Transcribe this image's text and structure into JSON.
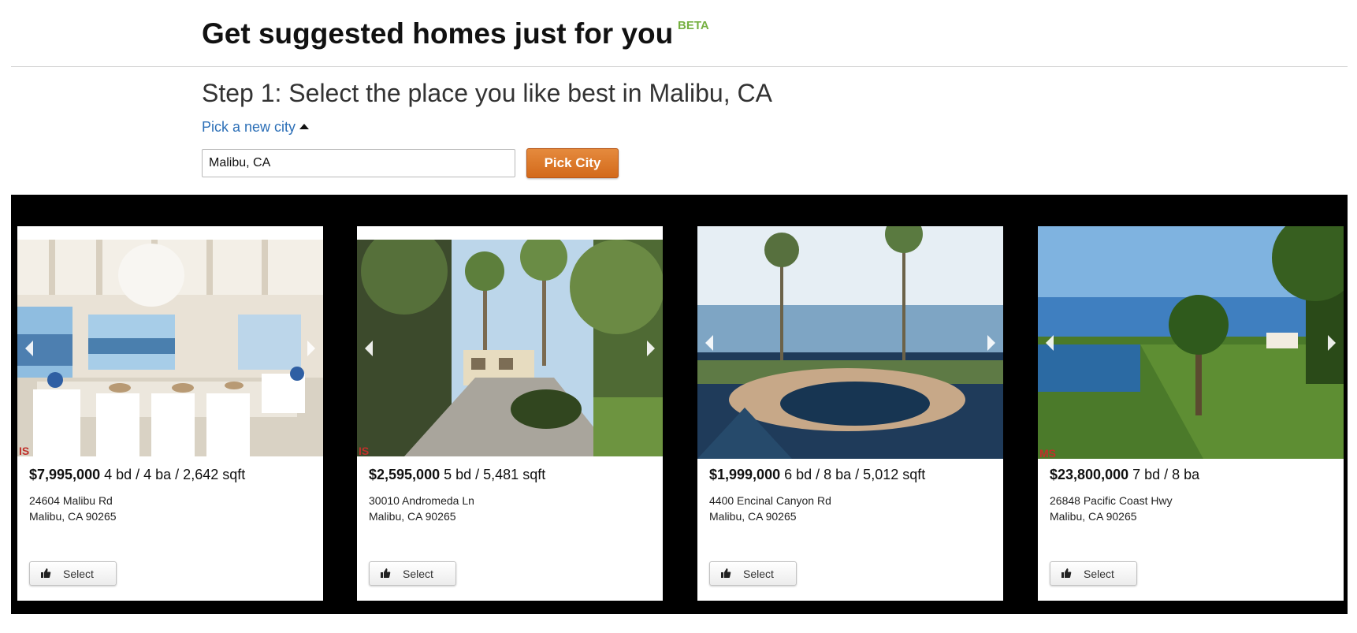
{
  "header": {
    "title": "Get suggested homes just for you",
    "badge": "BETA"
  },
  "step": {
    "title": "Step 1: Select the place you like best in Malibu, CA",
    "pick_link": "Pick a new city",
    "city_value": "Malibu, CA",
    "pick_button": "Pick City"
  },
  "colors": {
    "accent_orange": "#d9732a",
    "link_blue": "#2c6fb7",
    "beta_green": "#76b041",
    "strip_background": "#000000"
  },
  "icons": {
    "carousel_prev": "caret-left-icon",
    "carousel_next": "caret-right-icon",
    "select": "thumbs-up-icon",
    "link_toggle": "caret-up-icon"
  },
  "listings": [
    {
      "price": "$7,995,000",
      "details": "4 bd / 4 ba / 2,642 sqft",
      "address1": "24604 Malibu Rd",
      "address2": "Malibu, CA 90265",
      "select_label": "Select"
    },
    {
      "price": "$2,595,000",
      "details": "5 bd / 5,481 sqft",
      "address1": "30010 Andromeda Ln",
      "address2": "Malibu, CA 90265",
      "select_label": "Select"
    },
    {
      "price": "$1,999,000",
      "details": "6 bd / 8 ba / 5,012 sqft",
      "address1": "4400 Encinal Canyon Rd",
      "address2": "Malibu, CA 90265",
      "select_label": "Select"
    },
    {
      "price": "$23,800,000",
      "details": "7 bd / 8 ba",
      "address1": "26848 Pacific Coast Hwy",
      "address2": "Malibu, CA 90265",
      "select_label": "Select"
    }
  ]
}
